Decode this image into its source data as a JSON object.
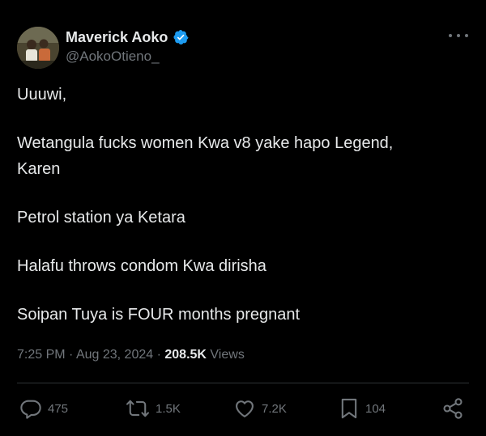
{
  "author": {
    "name": "Maverick Aoko",
    "handle": "@AokoOtieno_",
    "verified": true,
    "verified_color": "#1d9bf0"
  },
  "tweet": {
    "lines": [
      "Uuuwi,",
      "Wetangula fucks women Kwa v8 yake hapo Legend,",
      "Karen",
      "Petrol station ya Ketara",
      "Halafu throws condom Kwa dirisha",
      "Soipan Tuya is FOUR months pregnant"
    ]
  },
  "meta": {
    "time": "7:25 PM",
    "separator": "·",
    "date": "Aug 23, 2024",
    "views_count": "208.5K",
    "views_label": "Views"
  },
  "actions": {
    "reply": {
      "icon": "reply-icon",
      "count": "475"
    },
    "retweet": {
      "icon": "retweet-icon",
      "count": "1.5K"
    },
    "like": {
      "icon": "heart-icon",
      "count": "7.2K"
    },
    "bookmark": {
      "icon": "bookmark-icon",
      "count": "104"
    },
    "share": {
      "icon": "share-icon"
    }
  },
  "colors": {
    "background": "#000000",
    "text_primary": "#e7e9ea",
    "text_secondary": "#71767b",
    "divider": "#2f3336"
  }
}
